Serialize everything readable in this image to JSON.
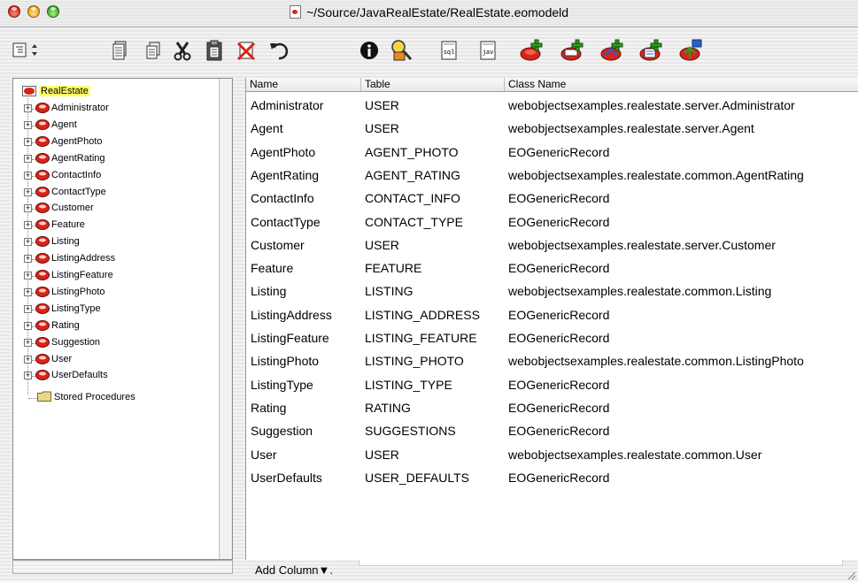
{
  "window": {
    "title": "~/Source/JavaRealEstate/RealEstate.eomodeld"
  },
  "toolbar": {
    "items": [
      {
        "name": "view-mode-popup"
      },
      {
        "name": "new-document"
      },
      {
        "name": "copy"
      },
      {
        "name": "cut"
      },
      {
        "name": "paste"
      },
      {
        "name": "delete"
      },
      {
        "name": "undo"
      },
      {
        "name": "inspector"
      },
      {
        "name": "browse-data"
      },
      {
        "name": "generate-sql"
      },
      {
        "name": "generate-java"
      },
      {
        "name": "add-entity"
      },
      {
        "name": "add-attribute"
      },
      {
        "name": "add-relationship"
      },
      {
        "name": "add-fetch-spec"
      },
      {
        "name": "add-stored-procedure"
      }
    ]
  },
  "tree": {
    "root": "RealEstate",
    "items": [
      "Administrator",
      "Agent",
      "AgentPhoto",
      "AgentRating",
      "ContactInfo",
      "ContactType",
      "Customer",
      "Feature",
      "Listing",
      "ListingAddress",
      "ListingFeature",
      "ListingPhoto",
      "ListingType",
      "Rating",
      "Suggestion",
      "User",
      "UserDefaults"
    ],
    "stored_procedures": "Stored Procedures",
    "expand_symbol": "+"
  },
  "table": {
    "headers": [
      "Name",
      "Table",
      "Class Name"
    ],
    "rows": [
      {
        "name": "Administrator",
        "table": "USER",
        "class": "webobjectsexamples.realestate.server.Administrator"
      },
      {
        "name": "Agent",
        "table": "USER",
        "class": "webobjectsexamples.realestate.server.Agent"
      },
      {
        "name": "AgentPhoto",
        "table": "AGENT_PHOTO",
        "class": "EOGenericRecord"
      },
      {
        "name": "AgentRating",
        "table": "AGENT_RATING",
        "class": "webobjectsexamples.realestate.common.AgentRating"
      },
      {
        "name": "ContactInfo",
        "table": "CONTACT_INFO",
        "class": "EOGenericRecord"
      },
      {
        "name": "ContactType",
        "table": "CONTACT_TYPE",
        "class": "EOGenericRecord"
      },
      {
        "name": "Customer",
        "table": "USER",
        "class": "webobjectsexamples.realestate.server.Customer"
      },
      {
        "name": "Feature",
        "table": "FEATURE",
        "class": "EOGenericRecord"
      },
      {
        "name": "Listing",
        "table": "LISTING",
        "class": "webobjectsexamples.realestate.common.Listing"
      },
      {
        "name": "ListingAddress",
        "table": "LISTING_ADDRESS",
        "class": "EOGenericRecord"
      },
      {
        "name": "ListingFeature",
        "table": "LISTING_FEATURE",
        "class": "EOGenericRecord"
      },
      {
        "name": "ListingPhoto",
        "table": "LISTING_PHOTO",
        "class": "webobjectsexamples.realestate.common.ListingPhoto"
      },
      {
        "name": "ListingType",
        "table": "LISTING_TYPE",
        "class": "EOGenericRecord"
      },
      {
        "name": "Rating",
        "table": "RATING",
        "class": "EOGenericRecord"
      },
      {
        "name": "Suggestion",
        "table": "SUGGESTIONS",
        "class": "EOGenericRecord"
      },
      {
        "name": "User",
        "table": "USER",
        "class": "webobjectsexamples.realestate.common.User"
      },
      {
        "name": "UserDefaults",
        "table": "USER_DEFAULTS",
        "class": "EOGenericRecord"
      }
    ],
    "add_column_label": "Add Column▼."
  },
  "colors": {
    "entity_red": "#d8241b",
    "selection": "#ffff66",
    "folder": "#e8d98a"
  }
}
